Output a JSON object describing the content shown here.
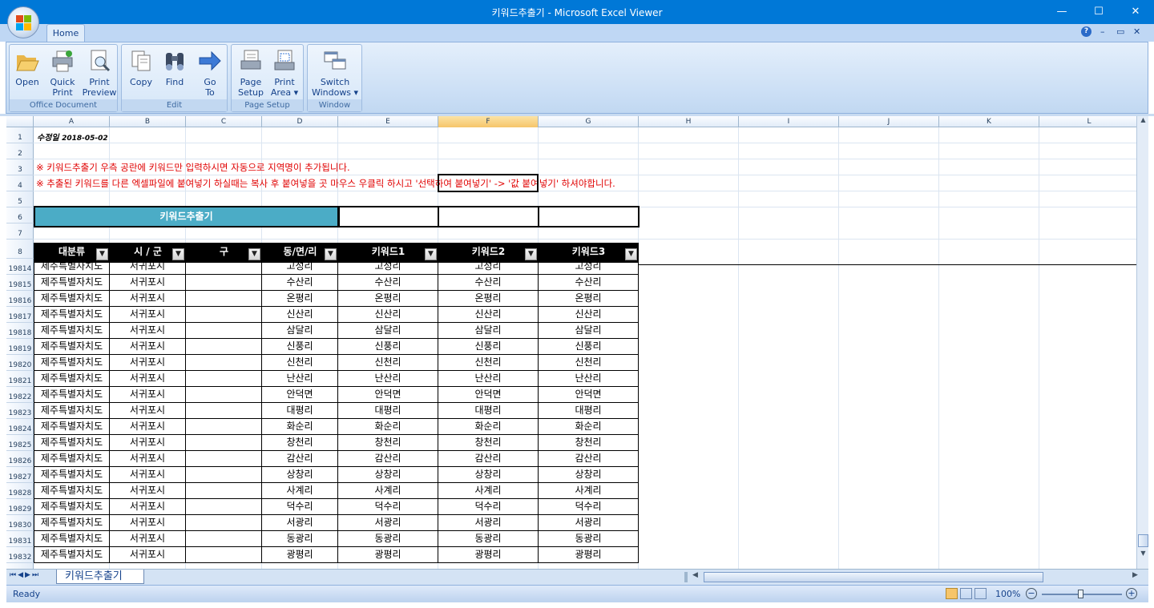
{
  "window": {
    "title": "키워드추출기 - Microsoft Excel Viewer",
    "minimize": "—",
    "maximize": "☐",
    "close": "✕"
  },
  "ribbon": {
    "tab_home": "Home",
    "help_icon": "?",
    "groups": [
      {
        "label": "Office Document",
        "buttons": [
          "Open",
          "Quick Print",
          "Print Preview"
        ]
      },
      {
        "label": "Edit",
        "buttons": [
          "Copy",
          "Find",
          "Go To"
        ]
      },
      {
        "label": "Page Setup",
        "buttons": [
          "Page Setup",
          "Print Area ▾"
        ]
      },
      {
        "label": "Window",
        "buttons": [
          "Switch Windows ▾"
        ]
      }
    ]
  },
  "columns": [
    "A",
    "B",
    "C",
    "D",
    "E",
    "F",
    "G",
    "H",
    "I",
    "J",
    "K",
    "L"
  ],
  "selected_column": "F",
  "top_rows": [
    "1",
    "2",
    "3",
    "4",
    "5",
    "6",
    "7",
    "8"
  ],
  "sheet": {
    "modified_label": "수정일",
    "modified_date": "2018-05-02",
    "note1": "※ 키워드추출기 우측 공란에 키워드만 입력하시면 자동으로 지역명이 추가됩니다.",
    "note2": "※ 추출된 키워드를 다른 엑셀파일에 붙여넣기 하실때는 복사 후 붙여넣을 곳 마우스 우클릭 하시고 '선택하여 붙여넣기' -> '값 붙여넣기' 하셔야합니다.",
    "band_title": "키워드추출기",
    "headers": [
      "대분류",
      "시 / 군",
      "구",
      "동/면/리",
      "키워드1",
      "키워드2",
      "키워드3"
    ]
  },
  "table_rows": [
    {
      "row": "19814",
      "cells": [
        "제주특별자치도",
        "서귀포시",
        "",
        "고성리",
        "고성리",
        "고성리",
        "고성리"
      ]
    },
    {
      "row": "19815",
      "cells": [
        "제주특별자치도",
        "서귀포시",
        "",
        "수산리",
        "수산리",
        "수산리",
        "수산리"
      ]
    },
    {
      "row": "19816",
      "cells": [
        "제주특별자치도",
        "서귀포시",
        "",
        "온평리",
        "온평리",
        "온평리",
        "온평리"
      ]
    },
    {
      "row": "19817",
      "cells": [
        "제주특별자치도",
        "서귀포시",
        "",
        "신산리",
        "신산리",
        "신산리",
        "신산리"
      ]
    },
    {
      "row": "19818",
      "cells": [
        "제주특별자치도",
        "서귀포시",
        "",
        "삼달리",
        "삼달리",
        "삼달리",
        "삼달리"
      ]
    },
    {
      "row": "19819",
      "cells": [
        "제주특별자치도",
        "서귀포시",
        "",
        "신풍리",
        "신풍리",
        "신풍리",
        "신풍리"
      ]
    },
    {
      "row": "19820",
      "cells": [
        "제주특별자치도",
        "서귀포시",
        "",
        "신천리",
        "신천리",
        "신천리",
        "신천리"
      ]
    },
    {
      "row": "19821",
      "cells": [
        "제주특별자치도",
        "서귀포시",
        "",
        "난산리",
        "난산리",
        "난산리",
        "난산리"
      ]
    },
    {
      "row": "19822",
      "cells": [
        "제주특별자치도",
        "서귀포시",
        "",
        "안덕면",
        "안덕면",
        "안덕면",
        "안덕면"
      ]
    },
    {
      "row": "19823",
      "cells": [
        "제주특별자치도",
        "서귀포시",
        "",
        "대평리",
        "대평리",
        "대평리",
        "대평리"
      ]
    },
    {
      "row": "19824",
      "cells": [
        "제주특별자치도",
        "서귀포시",
        "",
        "화순리",
        "화순리",
        "화순리",
        "화순리"
      ]
    },
    {
      "row": "19825",
      "cells": [
        "제주특별자치도",
        "서귀포시",
        "",
        "창천리",
        "창천리",
        "창천리",
        "창천리"
      ]
    },
    {
      "row": "19826",
      "cells": [
        "제주특별자치도",
        "서귀포시",
        "",
        "감산리",
        "감산리",
        "감산리",
        "감산리"
      ]
    },
    {
      "row": "19827",
      "cells": [
        "제주특별자치도",
        "서귀포시",
        "",
        "상창리",
        "상창리",
        "상창리",
        "상창리"
      ]
    },
    {
      "row": "19828",
      "cells": [
        "제주특별자치도",
        "서귀포시",
        "",
        "사계리",
        "사계리",
        "사계리",
        "사계리"
      ]
    },
    {
      "row": "19829",
      "cells": [
        "제주특별자치도",
        "서귀포시",
        "",
        "덕수리",
        "덕수리",
        "덕수리",
        "덕수리"
      ]
    },
    {
      "row": "19830",
      "cells": [
        "제주특별자치도",
        "서귀포시",
        "",
        "서광리",
        "서광리",
        "서광리",
        "서광리"
      ]
    },
    {
      "row": "19831",
      "cells": [
        "제주특별자치도",
        "서귀포시",
        "",
        "동광리",
        "동광리",
        "동광리",
        "동광리"
      ]
    },
    {
      "row": "19832",
      "cells": [
        "제주특별자치도",
        "서귀포시",
        "",
        "광평리",
        "광평리",
        "광평리",
        "광평리"
      ]
    }
  ],
  "sheet_tab": "키워드추출기",
  "status": {
    "ready": "Ready",
    "zoom": "100%"
  }
}
